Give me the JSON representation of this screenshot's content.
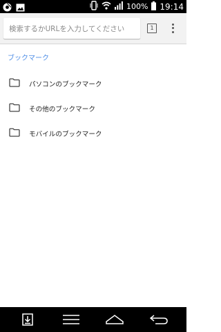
{
  "status_bar": {
    "battery_percent": "100%",
    "time": "19:14",
    "icons": [
      "chrome-icon",
      "image-icon",
      "vibrate-icon",
      "wifi-icon",
      "signal-icon",
      "battery-icon"
    ]
  },
  "toolbar": {
    "search_placeholder": "検索するかURLを入力してください",
    "tab_count": "1",
    "menu_icon": "more-vertical-icon"
  },
  "breadcrumb": "ブックマーク",
  "bookmark_folders": [
    {
      "label": "パソコンのブックマーク",
      "icon": "folder-icon"
    },
    {
      "label": "その他のブックマーク",
      "icon": "folder-icon"
    },
    {
      "label": "モバイルのブックマーク",
      "icon": "folder-icon"
    }
  ],
  "nav_bar": {
    "icons": [
      "download-icon",
      "menu-icon",
      "home-icon",
      "back-icon"
    ]
  },
  "colors": {
    "accent": "#4f8ee6",
    "status_bar": "#000000",
    "toolbar_bg": "#f2f2f2"
  }
}
